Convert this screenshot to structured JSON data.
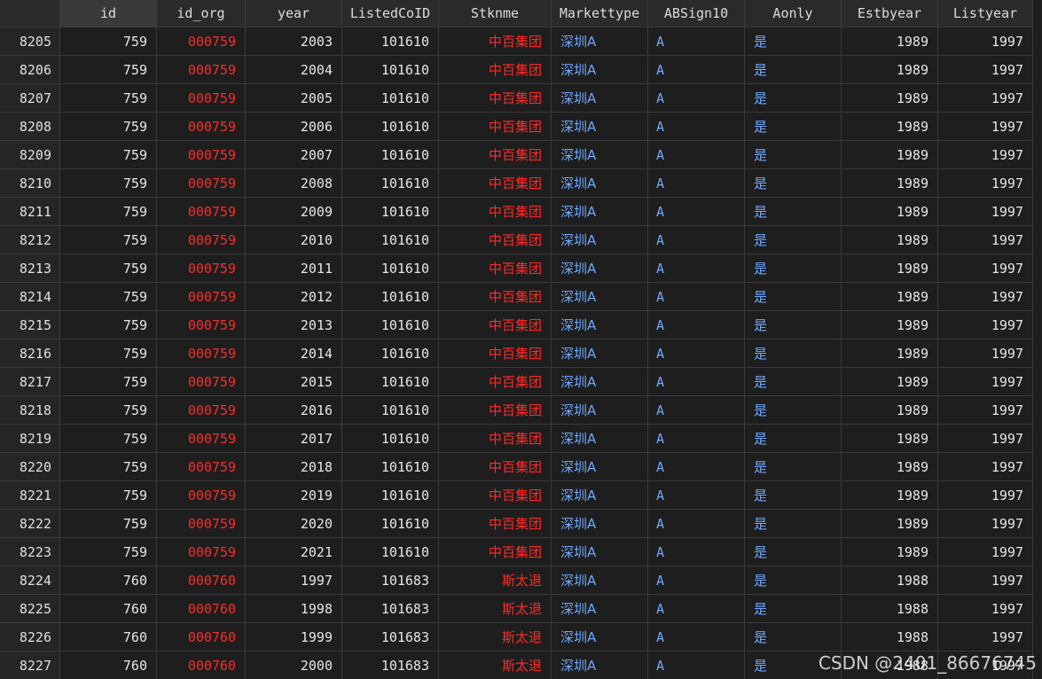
{
  "colors": {
    "background": "#1e1e1e",
    "header_bg": "#2a2a2a",
    "grid_line": "#3a3a3a",
    "string_red": "#ff2a2a",
    "label_blue": "#6fa8ff",
    "number_text": "#e6e6e6"
  },
  "table": {
    "columns": [
      "",
      "id",
      "id_org",
      "year",
      "ListedCoID",
      "Stknme",
      "Markettype",
      "ABSign10",
      "Aonly",
      "Estbyear",
      "Listyear"
    ],
    "rows": [
      [
        "8205",
        "759",
        "000759",
        "2003",
        "101610",
        "中百集团",
        "深圳A",
        "A",
        "是",
        "1989",
        "1997"
      ],
      [
        "8206",
        "759",
        "000759",
        "2004",
        "101610",
        "中百集团",
        "深圳A",
        "A",
        "是",
        "1989",
        "1997"
      ],
      [
        "8207",
        "759",
        "000759",
        "2005",
        "101610",
        "中百集团",
        "深圳A",
        "A",
        "是",
        "1989",
        "1997"
      ],
      [
        "8208",
        "759",
        "000759",
        "2006",
        "101610",
        "中百集团",
        "深圳A",
        "A",
        "是",
        "1989",
        "1997"
      ],
      [
        "8209",
        "759",
        "000759",
        "2007",
        "101610",
        "中百集团",
        "深圳A",
        "A",
        "是",
        "1989",
        "1997"
      ],
      [
        "8210",
        "759",
        "000759",
        "2008",
        "101610",
        "中百集团",
        "深圳A",
        "A",
        "是",
        "1989",
        "1997"
      ],
      [
        "8211",
        "759",
        "000759",
        "2009",
        "101610",
        "中百集团",
        "深圳A",
        "A",
        "是",
        "1989",
        "1997"
      ],
      [
        "8212",
        "759",
        "000759",
        "2010",
        "101610",
        "中百集团",
        "深圳A",
        "A",
        "是",
        "1989",
        "1997"
      ],
      [
        "8213",
        "759",
        "000759",
        "2011",
        "101610",
        "中百集团",
        "深圳A",
        "A",
        "是",
        "1989",
        "1997"
      ],
      [
        "8214",
        "759",
        "000759",
        "2012",
        "101610",
        "中百集团",
        "深圳A",
        "A",
        "是",
        "1989",
        "1997"
      ],
      [
        "8215",
        "759",
        "000759",
        "2013",
        "101610",
        "中百集团",
        "深圳A",
        "A",
        "是",
        "1989",
        "1997"
      ],
      [
        "8216",
        "759",
        "000759",
        "2014",
        "101610",
        "中百集团",
        "深圳A",
        "A",
        "是",
        "1989",
        "1997"
      ],
      [
        "8217",
        "759",
        "000759",
        "2015",
        "101610",
        "中百集团",
        "深圳A",
        "A",
        "是",
        "1989",
        "1997"
      ],
      [
        "8218",
        "759",
        "000759",
        "2016",
        "101610",
        "中百集团",
        "深圳A",
        "A",
        "是",
        "1989",
        "1997"
      ],
      [
        "8219",
        "759",
        "000759",
        "2017",
        "101610",
        "中百集团",
        "深圳A",
        "A",
        "是",
        "1989",
        "1997"
      ],
      [
        "8220",
        "759",
        "000759",
        "2018",
        "101610",
        "中百集团",
        "深圳A",
        "A",
        "是",
        "1989",
        "1997"
      ],
      [
        "8221",
        "759",
        "000759",
        "2019",
        "101610",
        "中百集团",
        "深圳A",
        "A",
        "是",
        "1989",
        "1997"
      ],
      [
        "8222",
        "759",
        "000759",
        "2020",
        "101610",
        "中百集团",
        "深圳A",
        "A",
        "是",
        "1989",
        "1997"
      ],
      [
        "8223",
        "759",
        "000759",
        "2021",
        "101610",
        "中百集团",
        "深圳A",
        "A",
        "是",
        "1989",
        "1997"
      ],
      [
        "8224",
        "760",
        "000760",
        "1997",
        "101683",
        "斯太退",
        "深圳A",
        "A",
        "是",
        "1988",
        "1997"
      ],
      [
        "8225",
        "760",
        "000760",
        "1998",
        "101683",
        "斯太退",
        "深圳A",
        "A",
        "是",
        "1988",
        "1997"
      ],
      [
        "8226",
        "760",
        "000760",
        "1999",
        "101683",
        "斯太退",
        "深圳A",
        "A",
        "是",
        "1988",
        "1997"
      ],
      [
        "8227",
        "760",
        "000760",
        "2000",
        "101683",
        "斯太退",
        "深圳A",
        "A",
        "是",
        "1988",
        "1997"
      ]
    ]
  },
  "watermark": "CSDN @2401_86676745"
}
